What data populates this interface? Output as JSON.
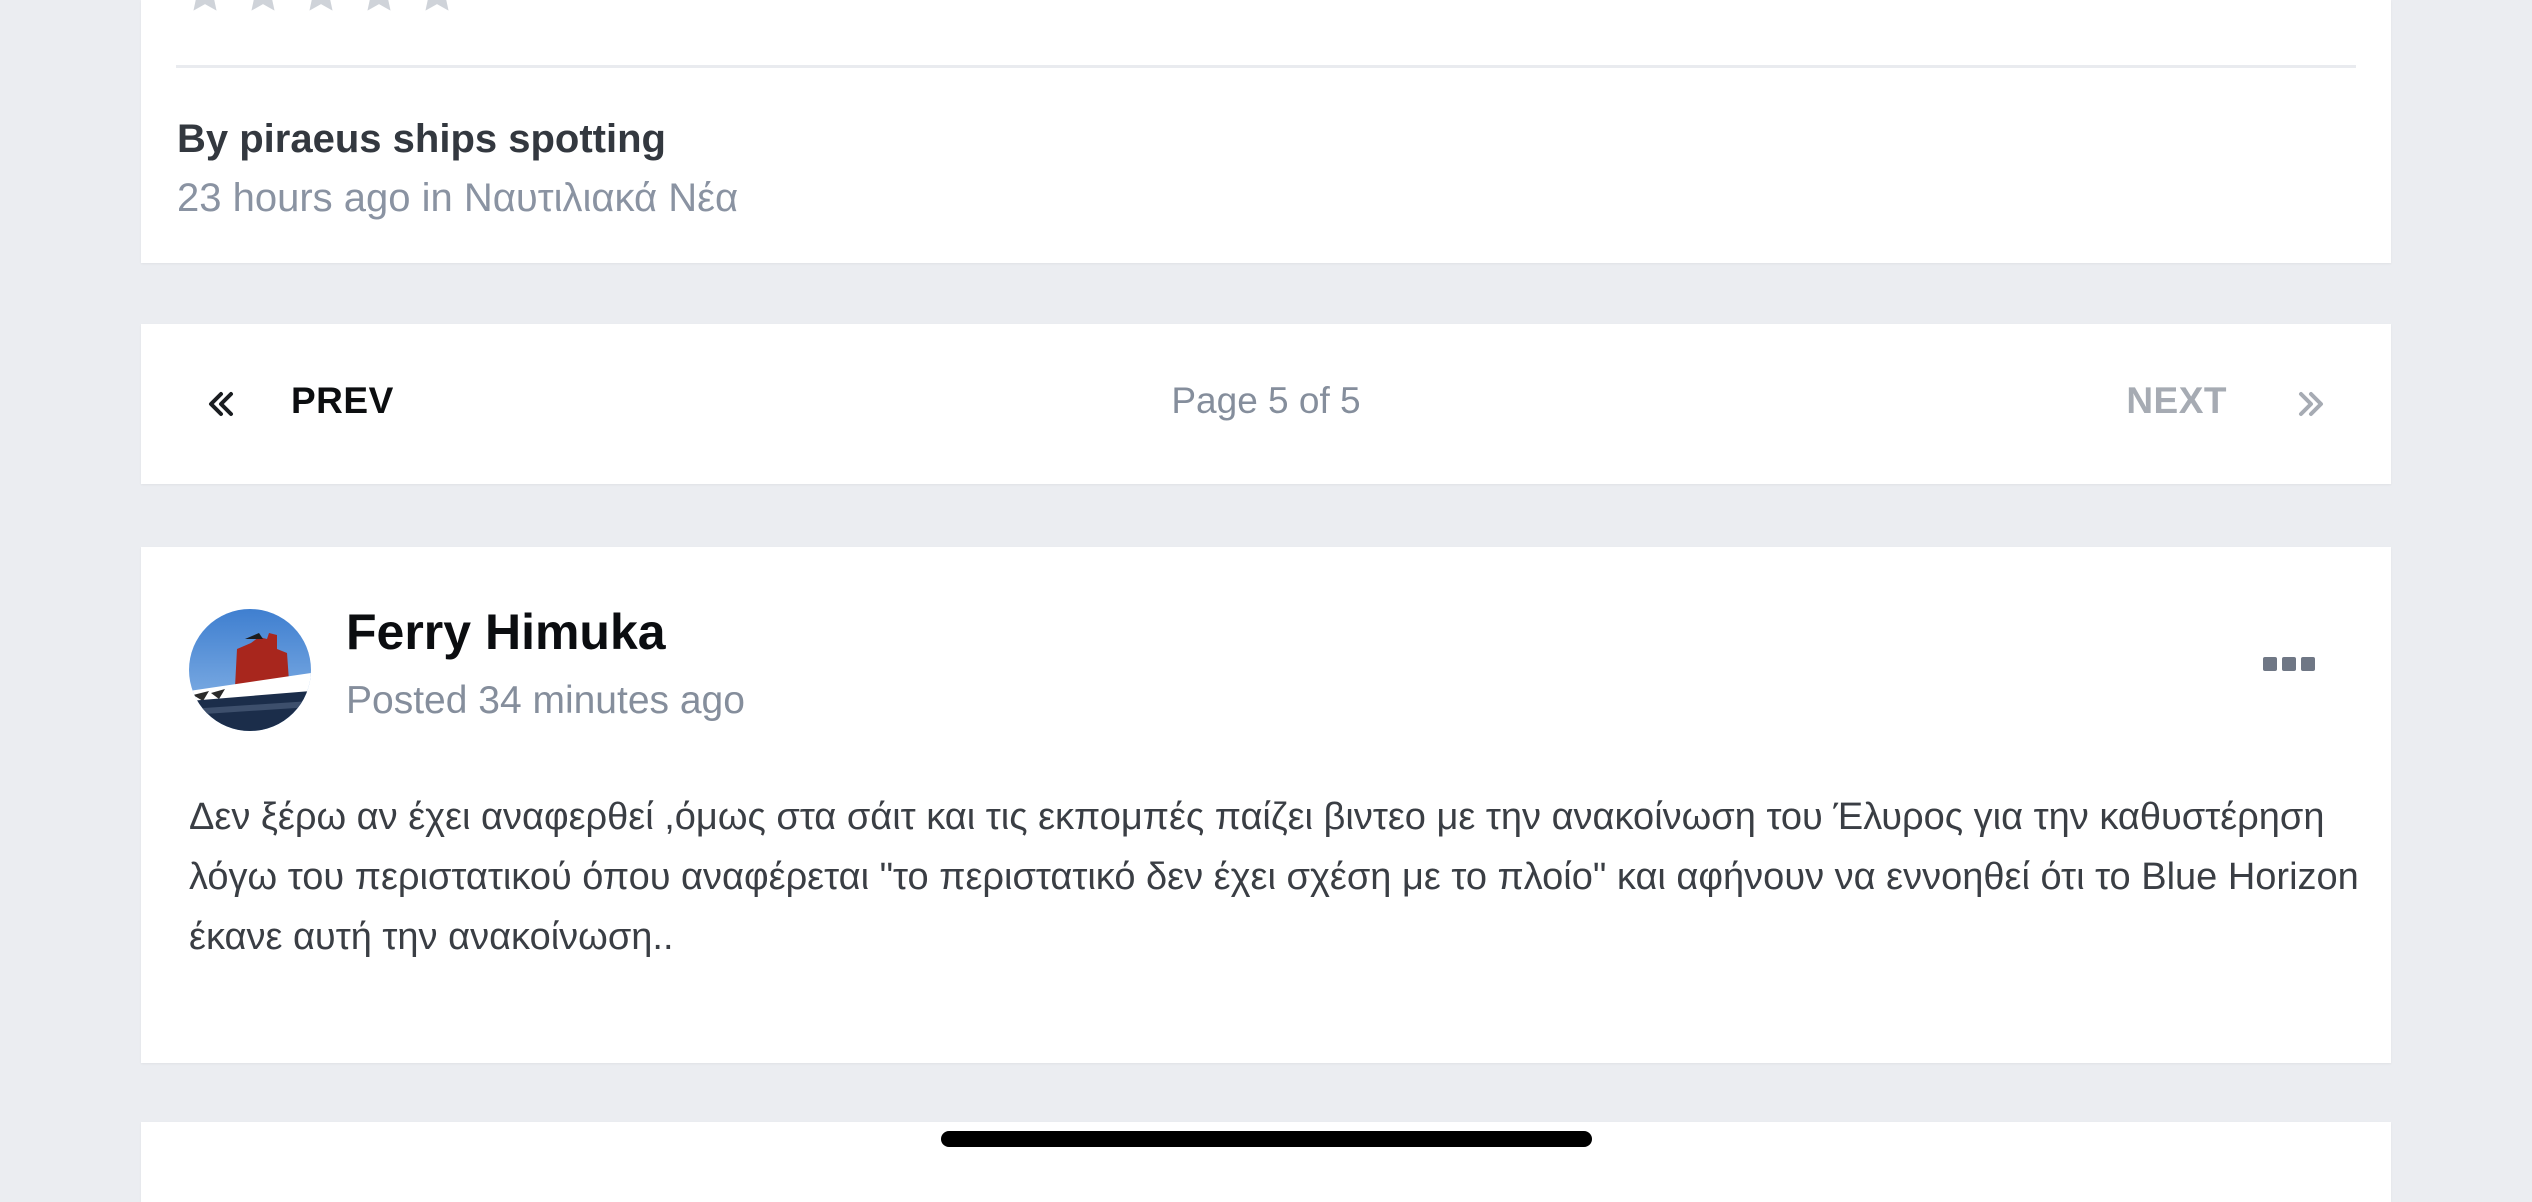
{
  "article": {
    "rating_stars": 5,
    "rating_value": 0,
    "byline": "By piraeus ships spotting",
    "time_ago": "23 hours ago",
    "in_word": "in",
    "category": "Ναυτιλιακά Νέα"
  },
  "pagination": {
    "prev_icon": "double-chevron-left-icon",
    "prev_label": "PREV",
    "status": "Page 5 of 5",
    "next_label": "NEXT",
    "next_icon": "double-chevron-right-icon"
  },
  "post": {
    "author": "Ferry Himuka",
    "posted": "Posted 34 minutes ago",
    "more_icon": "ellipsis-icon",
    "body": "Δεν ξέρω αν έχει αναφερθεί ,όμως στα σάιτ και τις εκπομπές παίζει βιντεο με την ανακοίνωση του Έλυρος για την καθυστέρηση λόγω του περιστατικού όπου αναφέρεται \"το περιστατικό δεν έχει σχέση με το πλοίο\" και αφήνουν να εννοηθεί ότι το Blue Horizon έκανε αυτή την ανακοίνωση.."
  },
  "colors": {
    "background": "#ebedf1",
    "card": "#ffffff",
    "muted_text": "#858e9c",
    "disabled_text": "#a6abb3"
  }
}
